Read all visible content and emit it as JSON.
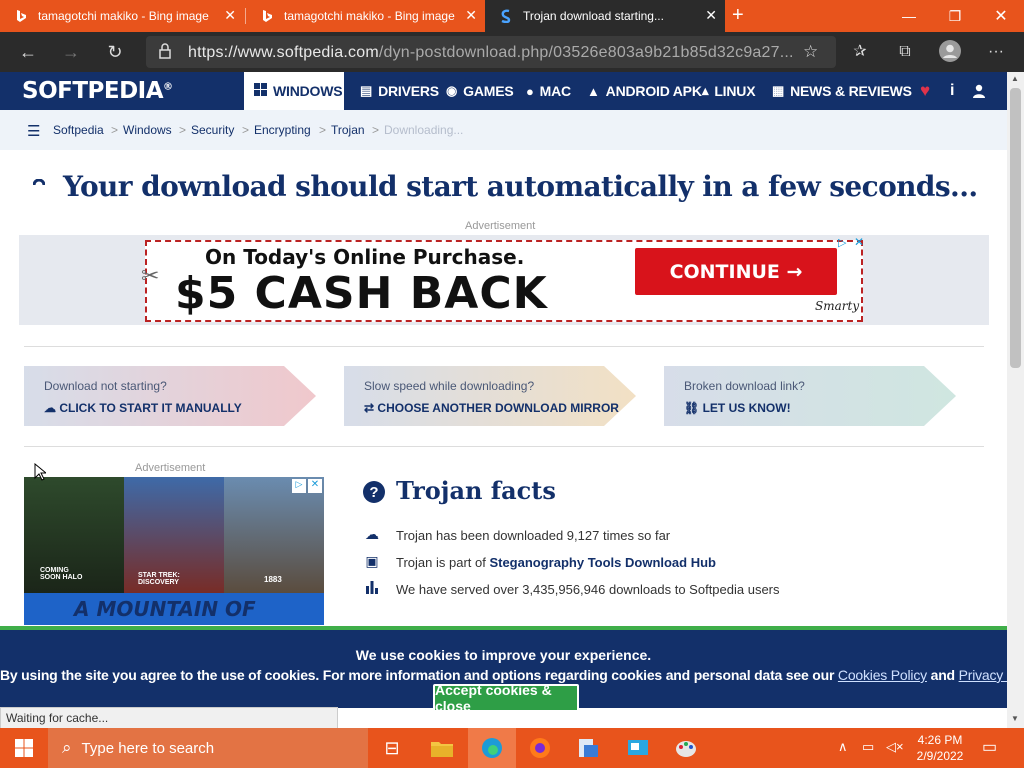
{
  "browser": {
    "tabs": [
      {
        "title": "tamagotchi makiko - Bing image",
        "icon": "bing-icon"
      },
      {
        "title": "tamagotchi makiko - Bing image",
        "icon": "bing-icon"
      },
      {
        "title": "Trojan download starting...",
        "icon": "softpedia-icon"
      }
    ],
    "url_host": "https://www.softpedia.com",
    "url_path": "/dyn-postdownload.php/03526e803a9b21b85d32c9a27..."
  },
  "site": {
    "logo": "SOFTPEDIA",
    "logo_mark": "®",
    "nav": [
      {
        "label": "WINDOWS",
        "icon": "windows-icon"
      },
      {
        "label": "DRIVERS",
        "icon": "drivers-icon"
      },
      {
        "label": "GAMES",
        "icon": "gamepad-icon"
      },
      {
        "label": "MAC",
        "icon": "apple-icon"
      },
      {
        "label": "ANDROID APK",
        "icon": "android-icon"
      },
      {
        "label": "LINUX",
        "icon": "linux-icon"
      },
      {
        "label": "NEWS & REVIEWS",
        "icon": "news-icon"
      }
    ],
    "breadcrumb": [
      "Softpedia",
      "Windows",
      "Security",
      "Encrypting",
      "Trojan",
      "Downloading..."
    ]
  },
  "main": {
    "headline": "Your download should start automatically in a few seconds...",
    "ad_label": "Advertisement",
    "ad": {
      "line1": "On Today's Online Purchase.",
      "line2": "$5 CASH BACK",
      "button": "CONTINUE →",
      "brand": "Smarty"
    },
    "help_boxes": [
      {
        "question": "Download not starting?",
        "action": "CLICK TO START IT MANUALLY",
        "icon": "cloud-download-icon"
      },
      {
        "question": "Slow speed while downloading?",
        "action": "CHOOSE ANOTHER DOWNLOAD MIRROR",
        "icon": "swap-icon"
      },
      {
        "question": "Broken download link?",
        "action": "LET US KNOW!",
        "icon": "link-icon"
      }
    ],
    "side_ad": {
      "label": "Advertisement",
      "tiles": [
        "COMING SOON HALO",
        "STAR TREK: DISCOVERY",
        "1883"
      ],
      "tagline": "A MOUNTAIN OF"
    },
    "facts": {
      "title": "Trojan facts",
      "items": [
        {
          "prefix": "Trojan has been downloaded 9,127 times so far",
          "link": "",
          "icon": "download-icon"
        },
        {
          "prefix": "Trojan is part of ",
          "link": "Steganography Tools Download Hub",
          "icon": "briefcase-icon"
        },
        {
          "prefix": "We have served over 3,435,956,946 downloads to Softpedia users",
          "link": "",
          "icon": "bar-chart-icon"
        }
      ]
    }
  },
  "cookie": {
    "title": "We use cookies to improve your experience.",
    "text": "By using the site you agree to the use of cookies. For more information and options regarding cookies and personal data see our ",
    "link1": "Cookies Policy",
    "and": " and ",
    "link2": "Privacy Policy",
    "button": "Accept cookies & close"
  },
  "status": "Waiting for cache...",
  "taskbar": {
    "search_placeholder": "Type here to search",
    "time": "4:26 PM",
    "date": "2/9/2022"
  },
  "colors": {
    "brand_navy": "#13306a",
    "tab_orange": "#e8541c",
    "ad_red": "#d8131b",
    "cookie_green": "#2e9e46"
  }
}
